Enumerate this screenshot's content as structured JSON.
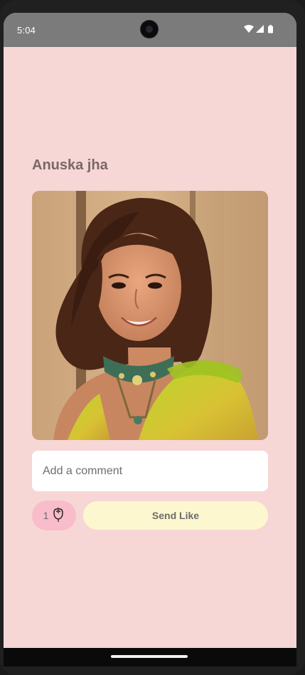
{
  "status_bar": {
    "time": "5:04",
    "icons": [
      "wifi-icon",
      "signal-icon",
      "battery-icon"
    ]
  },
  "profile": {
    "name": "Anuska jha",
    "photo_icon": "portrait-photo"
  },
  "comment": {
    "placeholder": "Add a comment",
    "value": ""
  },
  "rose_counter": {
    "count": "1",
    "icon": "rose-icon"
  },
  "actions": {
    "send_like_label": "Send Like"
  },
  "colors": {
    "background": "#f6d7d5",
    "status_bar": "#7b7b7b",
    "name_text": "#7a6767",
    "counter_bg": "#f9bccb",
    "send_like_bg": "#fdf7cf"
  }
}
